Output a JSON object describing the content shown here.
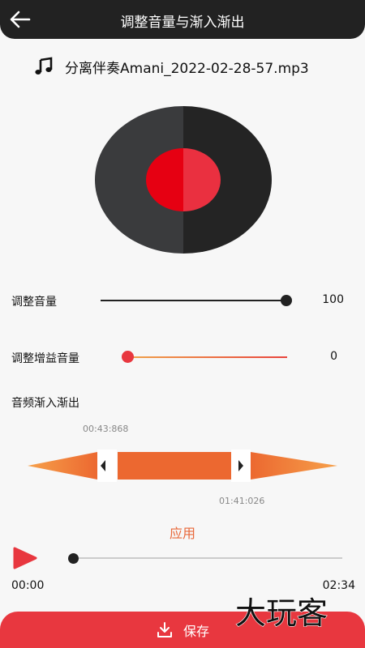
{
  "header": {
    "title": "调整音量与渐入渐出",
    "back_icon": "back-arrow-icon"
  },
  "file": {
    "icon": "music-note-icon",
    "name": "分离伴奏Amani_2022-02-28-57.mp3"
  },
  "volume": {
    "label": "调整音量",
    "value": "100",
    "level_percent": 100
  },
  "gain": {
    "label": "调整增益音量",
    "value": "0",
    "level_percent": 0
  },
  "fade": {
    "label": "音频渐入渐出",
    "start_time": "00:43:868",
    "end_time": "01:41:026"
  },
  "apply_label": "应用",
  "player": {
    "current_time": "00:00",
    "total_time": "02:34",
    "progress_percent": 0,
    "play_icon": "play-icon"
  },
  "save": {
    "label": "保存",
    "icon": "download-icon"
  },
  "watermark": "大玩客",
  "colors": {
    "accent_red": "#e8373f",
    "accent_orange": "#e8683a",
    "header_bg": "#222222"
  }
}
